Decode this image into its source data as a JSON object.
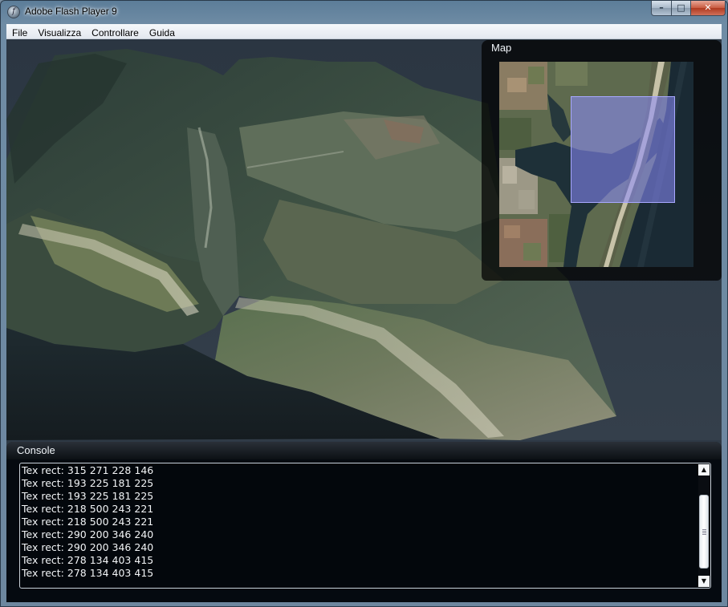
{
  "window": {
    "title": "Adobe Flash Player 9",
    "min_glyph": "–",
    "max_glyph": "□",
    "close_glyph": "✕",
    "icon_glyph": "f"
  },
  "menu": {
    "items": [
      "File",
      "Visualizza",
      "Controllare",
      "Guida"
    ]
  },
  "map": {
    "title": "Map"
  },
  "console": {
    "title": "Console",
    "lines": [
      "Tex rect: 315 271 228 146",
      "Tex rect: 193 225 181 225",
      "Tex rect: 193 225 181 225",
      "Tex rect: 218 500 243 221",
      "Tex rect: 218 500 243 221",
      "Tex rect: 290 200 346 240",
      "Tex rect: 290 200 346 240",
      "Tex rect: 278 134 403 415",
      "Tex rect: 278 134 403 415"
    ],
    "scroll_up_glyph": "▲",
    "scroll_down_glyph": "▼"
  }
}
